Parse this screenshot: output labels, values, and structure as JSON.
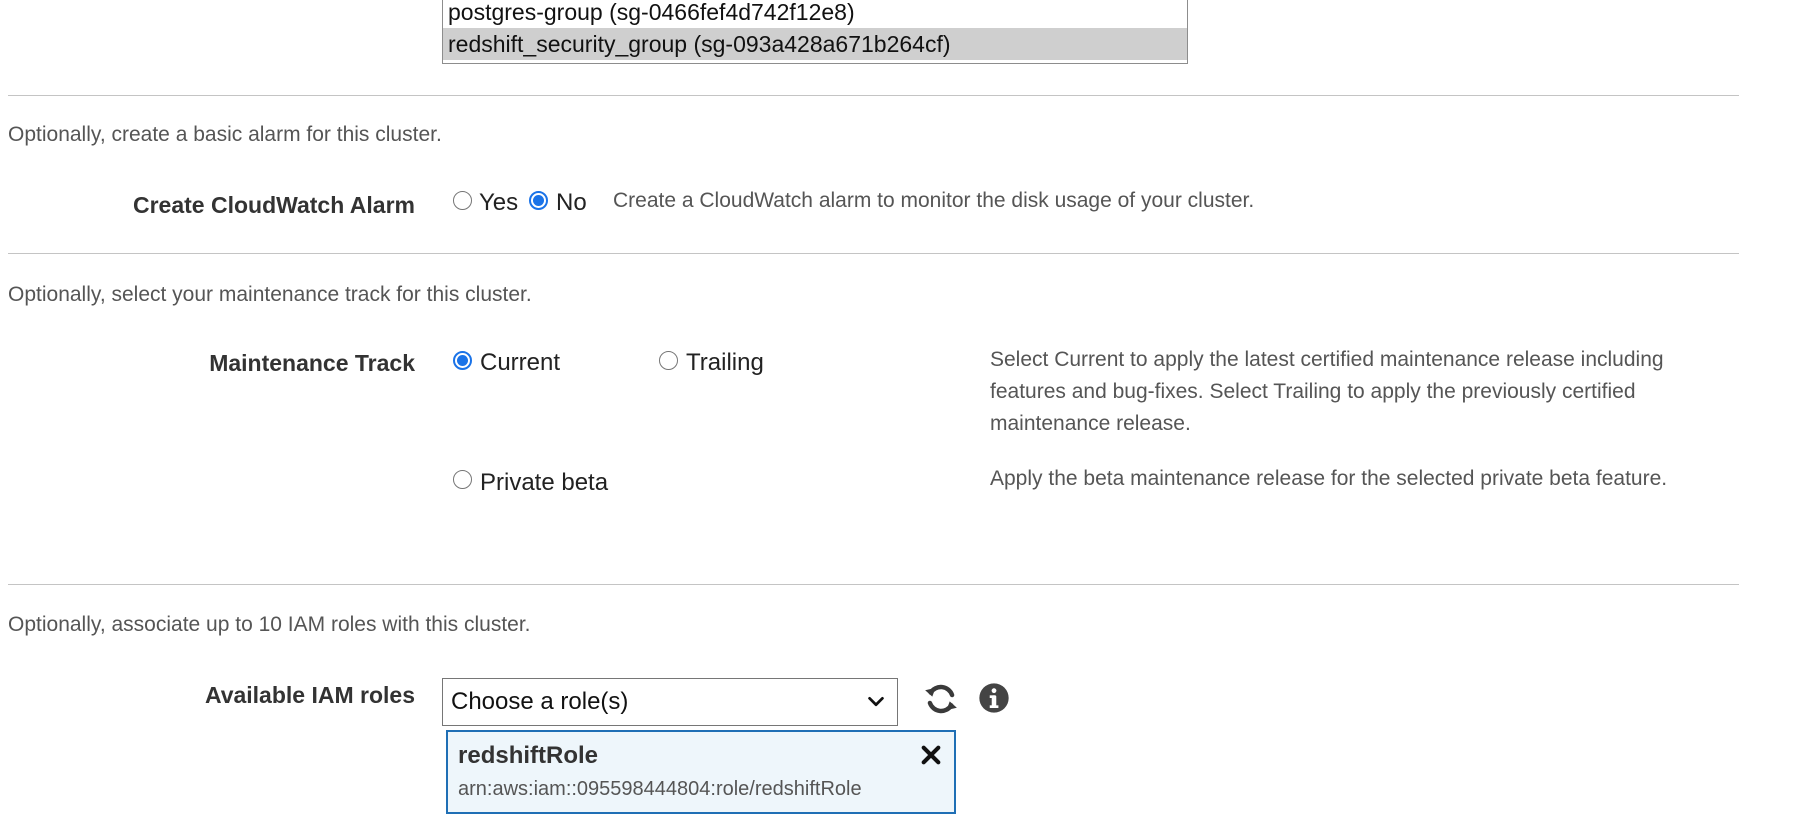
{
  "security_groups": {
    "options": [
      {
        "label": "postgres-group (sg-0466fef4d742f12e8)",
        "selected": false
      },
      {
        "label": "redshift_security_group (sg-093a428a671b264cf)",
        "selected": true
      }
    ]
  },
  "alarm_section": {
    "note": "Optionally, create a basic alarm for this cluster.",
    "label": "Create CloudWatch Alarm",
    "options": [
      {
        "label": "Yes",
        "checked": false
      },
      {
        "label": "No",
        "checked": true
      }
    ],
    "help": "Create a CloudWatch alarm to monitor the disk usage of your cluster."
  },
  "maintenance_section": {
    "note": "Optionally, select your maintenance track for this cluster.",
    "label": "Maintenance Track",
    "options": [
      {
        "label": "Current",
        "checked": true
      },
      {
        "label": "Trailing",
        "checked": false
      },
      {
        "label": "Private beta",
        "checked": false
      }
    ],
    "help_main_line1": "Select Current to apply the latest certified maintenance release including",
    "help_main_line2": "features and bug-fixes. Select Trailing to apply the previously certified",
    "help_main_line3": "maintenance release.",
    "help_beta": "Apply the beta maintenance release for the selected private beta feature."
  },
  "iam_section": {
    "note": "Optionally, associate up to 10 IAM roles with this cluster.",
    "label": "Available IAM roles",
    "select_value": "Choose a role(s)",
    "selected_roles": [
      {
        "name": "redshiftRole",
        "arn": "arn:aws:iam::095598444804:role/redshiftRole"
      }
    ],
    "icons": [
      "refresh-icon",
      "info-icon",
      "chevron-down-icon",
      "close-icon"
    ]
  },
  "colors": {
    "accent": "#1a73e8",
    "role_card_border": "#1f6fb5",
    "role_card_bg": "#eef6fb",
    "selected_option_bg": "#cfcfcf"
  }
}
